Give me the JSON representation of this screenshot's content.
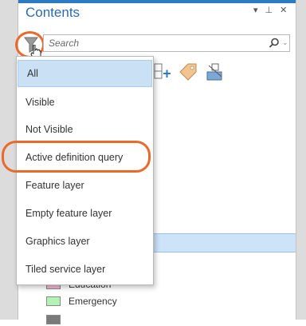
{
  "pane": {
    "title": "Contents",
    "controls": [
      "▾",
      "⊥",
      "✕"
    ]
  },
  "search": {
    "placeholder": "Search"
  },
  "filter_menu": {
    "items": [
      {
        "label": "All",
        "selected": true
      },
      {
        "label": "Visible",
        "selected": false
      },
      {
        "label": "Not Visible",
        "selected": false
      },
      {
        "label": "Active definition query",
        "selected": false
      },
      {
        "label": "Feature layer",
        "selected": false
      },
      {
        "label": "Empty feature layer",
        "selected": false
      },
      {
        "label": "Graphics layer",
        "selected": false
      },
      {
        "label": "Tiled service layer",
        "selected": false
      }
    ]
  },
  "legend": {
    "items": [
      {
        "label": "Education",
        "color": "#f3b8d4"
      },
      {
        "label": "Emergency",
        "color": "#b4f2b4"
      },
      {
        "label": "",
        "color": "#7a7a7a"
      }
    ]
  },
  "colors": {
    "accent": "#2a7bc3",
    "annotation": "#ea6a2b",
    "selection": "#c9e0f5"
  }
}
